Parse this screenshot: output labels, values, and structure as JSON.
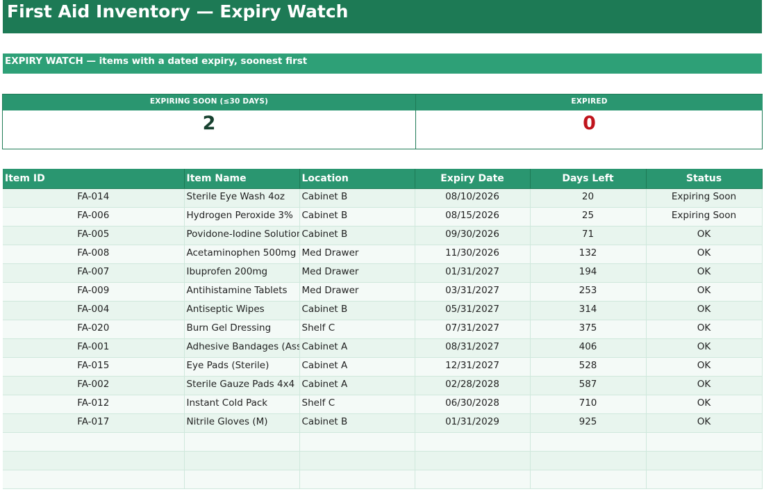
{
  "title": "First Aid Inventory — Expiry Watch",
  "subtitle": "EXPIRY WATCH — items with a dated expiry, soonest first",
  "kpis": {
    "soon_label": "EXPIRING SOON (≤30 DAYS)",
    "soon_value": "2",
    "expired_label": "EXPIRED",
    "expired_value": "0"
  },
  "colors": {
    "header_dark": "#1d7a55",
    "header_mid": "#2a9670",
    "row_odd": "#e8f5ee",
    "row_even": "#f4faf7",
    "expired_red": "#c0141c"
  },
  "table": {
    "columns": [
      "Item ID",
      "Item Name",
      "Location",
      "Expiry Date",
      "Days Left",
      "Status"
    ],
    "rows": [
      [
        "FA-014",
        "Sterile Eye Wash 4oz",
        "Cabinet B",
        "08/10/2026",
        "20",
        "Expiring Soon"
      ],
      [
        "FA-006",
        "Hydrogen Peroxide 3%",
        "Cabinet B",
        "08/15/2026",
        "25",
        "Expiring Soon"
      ],
      [
        "FA-005",
        "Povidone-Iodine Solution",
        "Cabinet B",
        "09/30/2026",
        "71",
        "OK"
      ],
      [
        "FA-008",
        "Acetaminophen 500mg",
        "Med Drawer",
        "11/30/2026",
        "132",
        "OK"
      ],
      [
        "FA-007",
        "Ibuprofen 200mg",
        "Med Drawer",
        "01/31/2027",
        "194",
        "OK"
      ],
      [
        "FA-009",
        "Antihistamine Tablets",
        "Med Drawer",
        "03/31/2027",
        "253",
        "OK"
      ],
      [
        "FA-004",
        "Antiseptic Wipes",
        "Cabinet B",
        "05/31/2027",
        "314",
        "OK"
      ],
      [
        "FA-020",
        "Burn Gel Dressing",
        "Shelf C",
        "07/31/2027",
        "375",
        "OK"
      ],
      [
        "FA-001",
        "Adhesive Bandages (Asso",
        "Cabinet A",
        "08/31/2027",
        "406",
        "OK"
      ],
      [
        "FA-015",
        "Eye Pads (Sterile)",
        "Cabinet A",
        "12/31/2027",
        "528",
        "OK"
      ],
      [
        "FA-002",
        "Sterile Gauze Pads 4x4",
        "Cabinet A",
        "02/28/2028",
        "587",
        "OK"
      ],
      [
        "FA-012",
        "Instant Cold Pack",
        "Shelf C",
        "06/30/2028",
        "710",
        "OK"
      ],
      [
        "FA-017",
        "Nitrile Gloves (M)",
        "Cabinet B",
        "01/31/2029",
        "925",
        "OK"
      ],
      [
        "",
        "",
        "",
        "",
        "",
        ""
      ],
      [
        "",
        "",
        "",
        "",
        "",
        ""
      ],
      [
        "",
        "",
        "",
        "",
        "",
        ""
      ]
    ]
  }
}
